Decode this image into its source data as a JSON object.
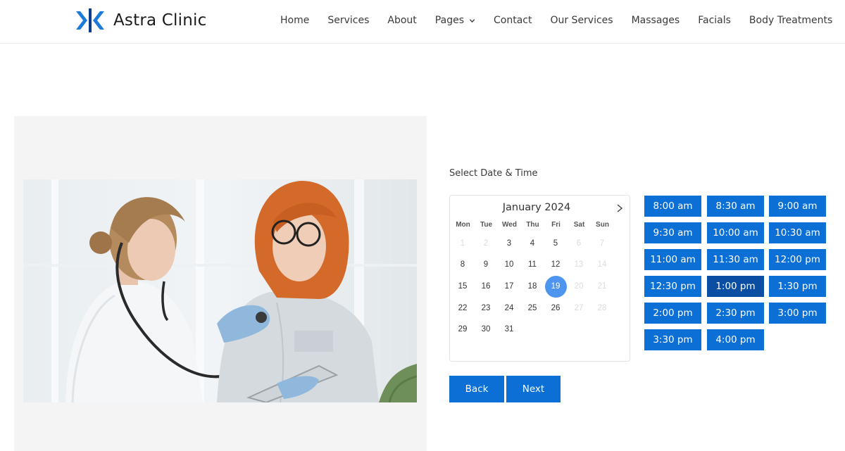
{
  "brand": {
    "name": "Astra Clinic",
    "logo_color": "#1a7bd8"
  },
  "nav": {
    "items": [
      {
        "label": "Home"
      },
      {
        "label": "Services"
      },
      {
        "label": "About"
      },
      {
        "label": "Pages",
        "has_dropdown": true
      },
      {
        "label": "Contact"
      },
      {
        "label": "Our Services"
      },
      {
        "label": "Massages"
      },
      {
        "label": "Facials"
      },
      {
        "label": "Body Treatments"
      }
    ]
  },
  "booking": {
    "section_label": "Select Date & Time",
    "calendar": {
      "month_label": "January 2024",
      "weekdays": [
        "Mon",
        "Tue",
        "Wed",
        "Thu",
        "Fri",
        "Sat",
        "Sun"
      ],
      "weeks": [
        [
          {
            "d": "1",
            "disabled": true
          },
          {
            "d": "2",
            "disabled": true
          },
          {
            "d": "3"
          },
          {
            "d": "4"
          },
          {
            "d": "5"
          },
          {
            "d": "6",
            "disabled": true
          },
          {
            "d": "7",
            "disabled": true
          }
        ],
        [
          {
            "d": "8"
          },
          {
            "d": "9"
          },
          {
            "d": "10"
          },
          {
            "d": "11"
          },
          {
            "d": "12"
          },
          {
            "d": "13",
            "disabled": true
          },
          {
            "d": "14",
            "disabled": true
          }
        ],
        [
          {
            "d": "15"
          },
          {
            "d": "16"
          },
          {
            "d": "17"
          },
          {
            "d": "18"
          },
          {
            "d": "19",
            "selected": true
          },
          {
            "d": "20",
            "disabled": true
          },
          {
            "d": "21",
            "disabled": true
          }
        ],
        [
          {
            "d": "22"
          },
          {
            "d": "23"
          },
          {
            "d": "24"
          },
          {
            "d": "25"
          },
          {
            "d": "26"
          },
          {
            "d": "27",
            "disabled": true
          },
          {
            "d": "28",
            "disabled": true
          }
        ],
        [
          {
            "d": "29"
          },
          {
            "d": "30"
          },
          {
            "d": "31"
          }
        ]
      ],
      "selected_date": "19"
    },
    "time_slots": [
      {
        "label": "8:00 am"
      },
      {
        "label": "8:30 am"
      },
      {
        "label": "9:00 am"
      },
      {
        "label": "9:30 am"
      },
      {
        "label": "10:00 am"
      },
      {
        "label": "10:30 am"
      },
      {
        "label": "11:00 am"
      },
      {
        "label": "11:30 am"
      },
      {
        "label": "12:00 pm"
      },
      {
        "label": "12:30 pm"
      },
      {
        "label": "1:00 pm",
        "active": true
      },
      {
        "label": "1:30 pm"
      },
      {
        "label": "2:00 pm"
      },
      {
        "label": "2:30 pm"
      },
      {
        "label": "3:00 pm"
      },
      {
        "label": "3:30 pm"
      },
      {
        "label": "4:00 pm"
      }
    ],
    "back_label": "Back",
    "next_label": "Next"
  },
  "colors": {
    "primary_button": "#0b6fd6",
    "active_slot": "#0a4ea3",
    "selected_day": "#4e95ef"
  }
}
